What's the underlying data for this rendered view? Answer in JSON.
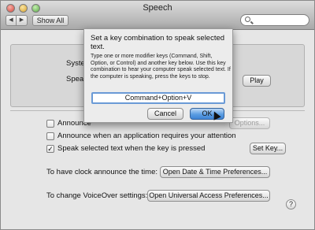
{
  "window": {
    "title": "Speech",
    "show_all_label": "Show All",
    "back_glyph": "◀",
    "forward_glyph": "▶"
  },
  "panel": {
    "system_voice_label": "System",
    "speaking_rate_label": "Speaki",
    "play_label": "Play"
  },
  "options": {
    "announce_alerts_label": "Announce",
    "set_alert_options_label": "Options...",
    "announce_app_attention_label": "Announce when an application requires your attention",
    "speak_selected_label": "Speak selected text when the key is pressed",
    "set_key_label": "Set Key...",
    "clock_label": "To have clock announce the time:",
    "clock_button_label": "Open Date & Time Preferences...",
    "voiceover_label": "To change VoiceOver settings:",
    "voiceover_button_label": "Open Universal Access Preferences...",
    "help_glyph": "?"
  },
  "sheet": {
    "title": "Set a key combination to speak selected text.",
    "description": "Type one or more modifier keys (Command, Shift, Option, or Control) and another key below. Use this key combination to hear your computer speak selected text. If the computer is speaking, press the keys to stop.",
    "key_value": "Command+Option+V",
    "cancel_label": "Cancel",
    "ok_label": "OK"
  },
  "checkbox_states": {
    "announce_alerts": false,
    "announce_app_attention": false,
    "speak_selected": true
  },
  "colors": {
    "ok_button": "#4a90e2",
    "key_field_border": "#6a9ad6"
  },
  "icons": [
    "close-icon",
    "minimize-icon",
    "zoom-icon",
    "back-arrow-icon",
    "forward-arrow-icon",
    "search-icon",
    "help-icon",
    "checkmark-icon",
    "pointer-cursor-icon"
  ]
}
